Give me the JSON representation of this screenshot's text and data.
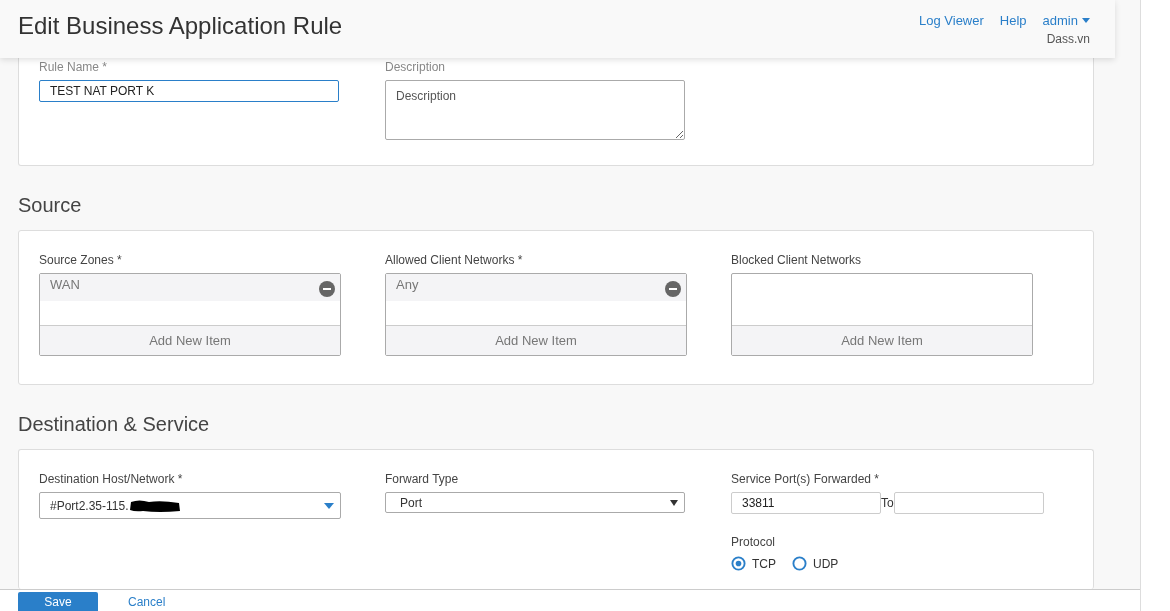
{
  "header": {
    "title": "Edit Business Application Rule",
    "links": [
      "Log Viewer",
      "Help"
    ],
    "user": "admin",
    "org": "Dass.vn"
  },
  "general": {
    "rule_name": {
      "label": "Rule Name *",
      "value": "TEST NAT PORT K"
    },
    "description": {
      "label": "Description",
      "placeholder": "Description"
    }
  },
  "source": {
    "title": "Source",
    "lists": [
      {
        "label": "Source Zones *",
        "items": [
          "WAN"
        ],
        "add_label": "Add New Item"
      },
      {
        "label": "Allowed Client Networks *",
        "items": [
          "Any"
        ],
        "add_label": "Add New Item"
      },
      {
        "label": "Blocked Client Networks",
        "add_label": "Add New Item"
      }
    ]
  },
  "destination": {
    "title": "Destination & Service",
    "host": {
      "label": "Destination Host/Network *",
      "value": "#Port2.35-115.",
      "redacted": true
    },
    "forward_type": {
      "label": "Forward Type",
      "value": "Port"
    },
    "ports": {
      "label": "Service Port(s) Forwarded *",
      "from": "33811",
      "to_label": "To"
    },
    "protocol": {
      "label": "Protocol",
      "options": [
        {
          "label": "TCP",
          "selected": true
        },
        {
          "label": "UDP",
          "selected": false
        }
      ]
    }
  },
  "footer": {
    "buttons": [
      {
        "label": "Save",
        "kind": "primary"
      },
      {
        "label": "Cancel",
        "kind": "link"
      }
    ]
  }
}
